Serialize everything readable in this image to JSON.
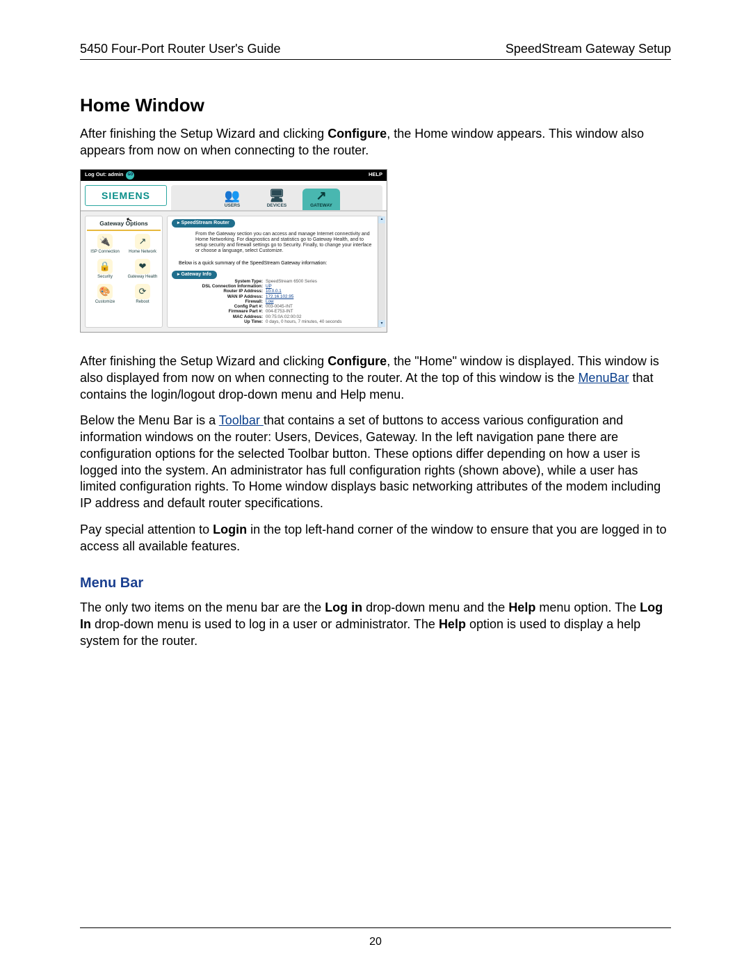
{
  "header": {
    "left": "5450 Four-Port Router User's Guide",
    "right": "SpeedStream Gateway Setup"
  },
  "title": "Home Window",
  "intro_before_bold": "After finishing the Setup Wizard and clicking ",
  "intro_bold": "Configure",
  "intro_after_bold": ", the Home window appears. This window also appears from now on when connecting to the router.",
  "screenshot": {
    "menubar": {
      "logout_label": "Log Out:  admin",
      "go": "GO",
      "help": "HELP"
    },
    "logo": "SIEMENS",
    "tabs": [
      {
        "label": "USERS",
        "icon": "👥"
      },
      {
        "label": "DEVICES",
        "icon": "🖥"
      },
      {
        "label": "GATEWAY",
        "icon": "↗",
        "selected": true
      }
    ],
    "sidebar": {
      "title": "Gateway Options",
      "items": [
        {
          "label": "ISP Connection",
          "icon": "🔌"
        },
        {
          "label": "Home Network",
          "icon": "↗"
        },
        {
          "label": "Security",
          "icon": "🔒"
        },
        {
          "label": "Gateway Health",
          "icon": "❤"
        },
        {
          "label": "Customize",
          "icon": "🎨"
        },
        {
          "label": "Reboot",
          "icon": "⟳"
        }
      ]
    },
    "main": {
      "pill_router": "▸  SpeedStream Router",
      "desc": "From the Gateway section you can access and manage Internet connectivity and Home Networking. For diagnostics and statistics go to Gateway Health, and to setup security and firewall settings go to Security. Finally, to change your interface or choose a language, select Customize.",
      "summary_lead": "Below is a quick summary of the SpeedStream Gateway information:",
      "pill_gateway": "▸  Gateway Info",
      "kv": [
        {
          "k": "System Type:",
          "v": "SpeedStream 6500 Series"
        },
        {
          "k": "DSL Connection Information:",
          "v": "UP",
          "link": true
        },
        {
          "k": "Router IP Address:",
          "v": "10.0.0.1",
          "link": true
        },
        {
          "k": "WAN IP Address:",
          "v": "172.16.102.95",
          "link": true
        },
        {
          "k": "Firewall:",
          "v": "Low",
          "link": true
        },
        {
          "k": "Config Part #:",
          "v": "003-0045-INT"
        },
        {
          "k": "Firmware Part #:",
          "v": "004-E753-INT"
        },
        {
          "k": "MAC Address:",
          "v": "00:75:0A:02:00:02"
        },
        {
          "k": "Up Time:",
          "v": "0 days, 0 hours, 7 minutes, 40 seconds"
        }
      ]
    }
  },
  "para2": {
    "t1": "After finishing the Setup Wizard and clicking ",
    "b1": "Configure",
    "t2": ", the \"Home\" window is displayed. This window is also displayed from now on when connecting to the router. At the top of this window is the ",
    "link1": "MenuBar",
    "t3": " that contains the login/logout drop-down menu and Help menu."
  },
  "para3": {
    "t1": "Below the Menu Bar is a ",
    "link1": "Toolbar ",
    "t2": "that contains a set of buttons to access various configuration and information windows on the router: Users, Devices, Gateway. In the left navigation pane there are configuration options for the selected Toolbar button. These options differ depending on how a user is logged into the system. An administrator has full configuration rights (shown above), while a user has limited configuration rights. To Home window displays basic networking attributes of the modem including IP address and default router specifications."
  },
  "para4": {
    "t1": "Pay special attention to ",
    "b1": "Login",
    "t2": " in the top left-hand corner of the window to ensure that you are logged in to access all available features."
  },
  "subsection": "Menu Bar",
  "para5": {
    "t1": "The only two items on the menu bar are the ",
    "b1": "Log in",
    "t2": " drop-down menu and the ",
    "b2": "Help",
    "t3": " menu option. The ",
    "b3": "Log In",
    "t4": " drop-down menu is used to log in a user or administrator. The ",
    "b4": "Help",
    "t5": " option is used to display a help system for the router."
  },
  "page_number": "20"
}
